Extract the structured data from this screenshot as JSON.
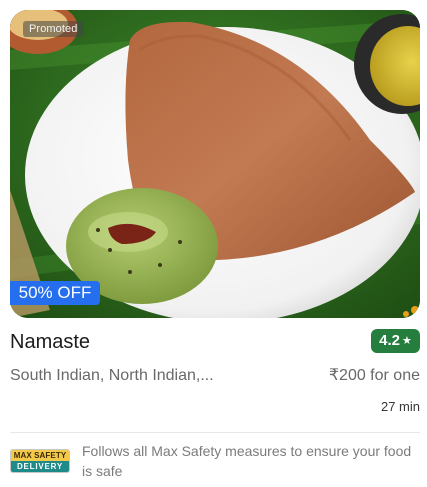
{
  "hero": {
    "promoted_label": "Promoted",
    "offer_label": "50% OFF"
  },
  "restaurant": {
    "name": "Namaste",
    "rating": "4.2",
    "rating_star": "★",
    "cuisines": "South Indian, North Indian,...",
    "price": "₹200 for one",
    "delivery_time": "27 min"
  },
  "safety": {
    "logo_top": "MAX SAFETY",
    "logo_bottom": "DELIVERY",
    "text": "Follows all Max Safety measures to ensure your food is safe"
  },
  "colors": {
    "rating_green": "#267e3e",
    "offer_blue": "#256fef",
    "muted_text": "#696969"
  },
  "icons": {
    "rating_star": "star-icon",
    "safety_logo": "max-safety-delivery-logo"
  }
}
